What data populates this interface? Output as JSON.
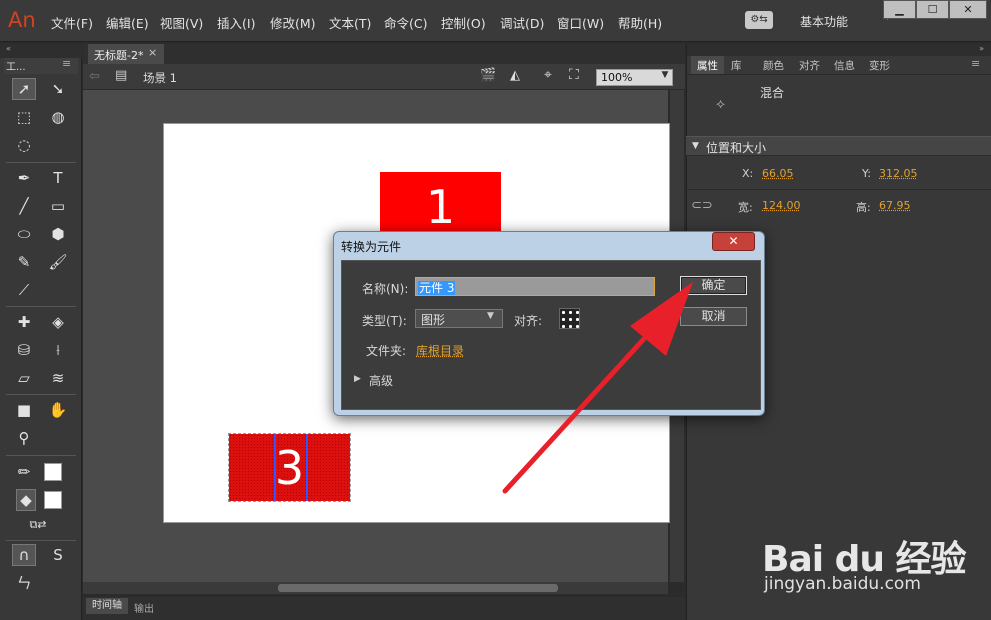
{
  "app": {
    "logo": "An",
    "workspace": "基本功能",
    "workspace_caret": "▾"
  },
  "menus": [
    "文件(F)",
    "编辑(E)",
    "视图(V)",
    "插入(I)",
    "修改(M)",
    "文本(T)",
    "命令(C)",
    "控制(O)",
    "调试(D)",
    "窗口(W)",
    "帮助(H)"
  ],
  "window_controls": {
    "minimize": "▁",
    "maximize": "☐",
    "close": "✕"
  },
  "tools_panel": {
    "title": "工...",
    "collapse": "«",
    "menu": "≡"
  },
  "document": {
    "tab": "无标题-2*",
    "tab_close": "×",
    "scene": "场景 1",
    "zoom": "100%"
  },
  "stage": {
    "rect1_label": "1",
    "rect3_label": "3",
    "rect_color": "#ff0000"
  },
  "bottom_tabs": {
    "timeline": "时间轴",
    "output": "输出"
  },
  "properties": {
    "tabs": [
      "属性",
      "库",
      "颜色",
      "对齐",
      "信息",
      "变形"
    ],
    "blend": "混合",
    "section": "位置和大小",
    "x_label": "X:",
    "x": "66.05",
    "y_label": "Y:",
    "y": "312.05",
    "w_label": "宽:",
    "w": "124.00",
    "h_label": "高:",
    "h": "67.95"
  },
  "dialog": {
    "title": "转换为元件",
    "close": "✕",
    "name_label": "名称(N):",
    "name_value": "元件 3",
    "type_label": "类型(T):",
    "type_value": "图形",
    "align_label": "对齐:",
    "folder_label": "文件夹:",
    "folder_value": "库根目录",
    "advanced": "高级",
    "ok": "确定",
    "cancel": "取消"
  },
  "watermark": {
    "brand": "Bai du 经验",
    "url": "jingyan.baidu.com"
  },
  "colors": {
    "accent": "#e5a02a",
    "arrow": "#e8202a",
    "dialog_frame": "#bcd1e6"
  }
}
